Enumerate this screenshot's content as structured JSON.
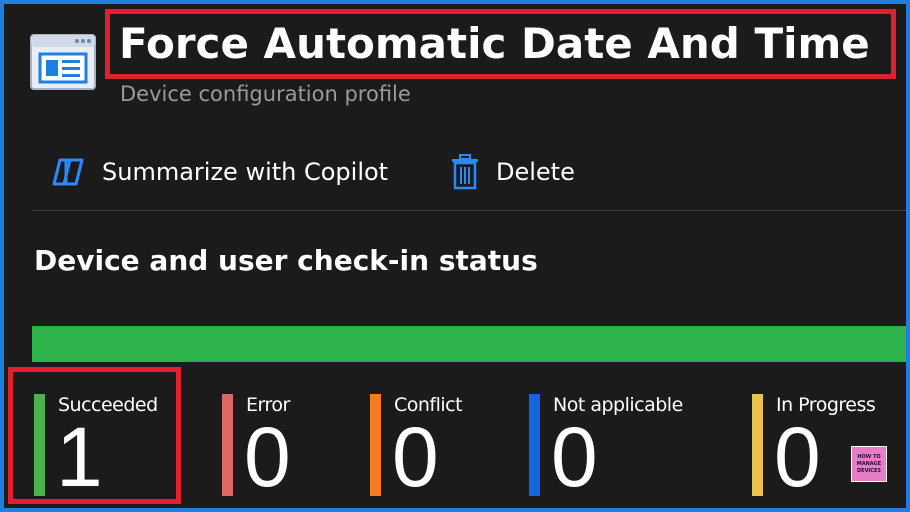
{
  "header": {
    "title": "Force Automatic Date And Time",
    "subtitle": "Device configuration profile",
    "icon": "profile-window-icon"
  },
  "toolbar": {
    "copilot_label": "Summarize with Copilot",
    "copilot_icon": "copilot-icon",
    "delete_label": "Delete",
    "delete_icon": "trash-icon"
  },
  "section": {
    "heading": "Device and user check-in status"
  },
  "progress": {
    "succeeded_fraction": 1.0,
    "color": "#2db34a"
  },
  "stats": [
    {
      "label": "Succeeded",
      "value": "1",
      "color": "#4caf50"
    },
    {
      "label": "Error",
      "value": "0",
      "color": "#e06666"
    },
    {
      "label": "Conflict",
      "value": "0",
      "color": "#f57c1f"
    },
    {
      "label": "Not applicable",
      "value": "0",
      "color": "#1565e0"
    },
    {
      "label": "In Progress",
      "value": "0",
      "color": "#e8c44a"
    }
  ],
  "highlight_color": "#e0202e",
  "logo": {
    "lines": [
      "HOW TO",
      "MANAGE",
      "DEVICES"
    ]
  }
}
